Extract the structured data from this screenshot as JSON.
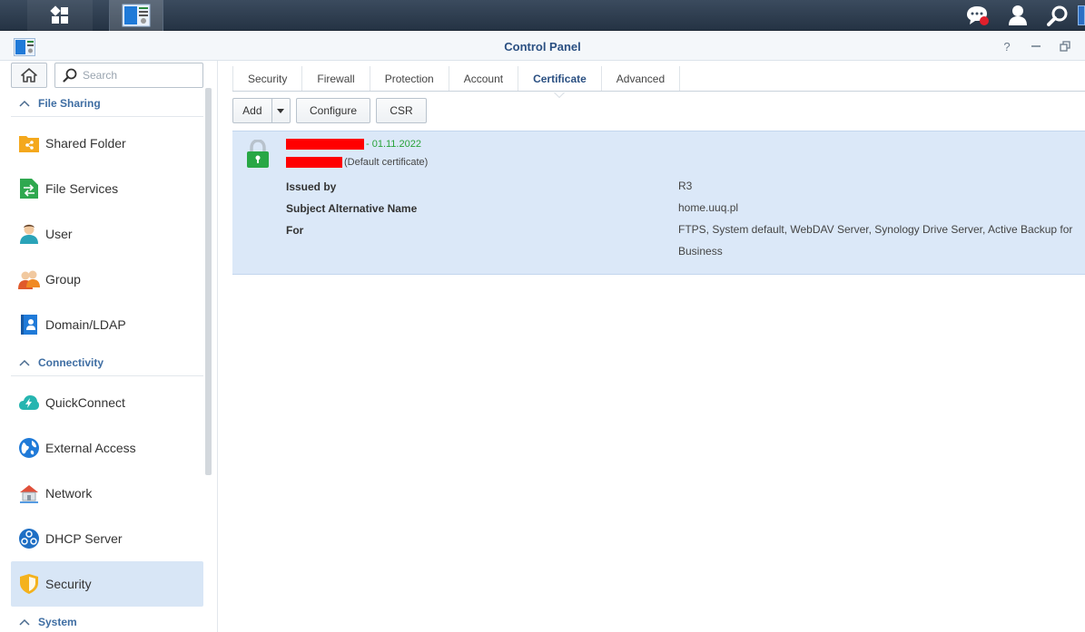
{
  "window": {
    "title": "Control Panel"
  },
  "sidebar": {
    "search_placeholder": "Search",
    "sections": [
      {
        "label": "File Sharing"
      },
      {
        "label": "Connectivity"
      },
      {
        "label": "System"
      }
    ],
    "items": [
      {
        "label": "Shared Folder",
        "icon": "shared-folder-icon"
      },
      {
        "label": "File Services",
        "icon": "file-services-icon"
      },
      {
        "label": "User",
        "icon": "user-icon"
      },
      {
        "label": "Group",
        "icon": "group-icon"
      },
      {
        "label": "Domain/LDAP",
        "icon": "domain-ldap-icon"
      },
      {
        "label": "QuickConnect",
        "icon": "quickconnect-icon"
      },
      {
        "label": "External Access",
        "icon": "external-access-icon"
      },
      {
        "label": "Network",
        "icon": "network-icon"
      },
      {
        "label": "DHCP Server",
        "icon": "dhcp-server-icon"
      },
      {
        "label": "Security",
        "icon": "security-icon",
        "active": true
      }
    ]
  },
  "tabs": [
    {
      "label": "Security"
    },
    {
      "label": "Firewall"
    },
    {
      "label": "Protection"
    },
    {
      "label": "Account"
    },
    {
      "label": "Certificate",
      "active": true
    },
    {
      "label": "Advanced"
    }
  ],
  "toolbar": {
    "add_label": "Add",
    "configure_label": "Configure",
    "csr_label": "CSR"
  },
  "certificate": {
    "expiry": "- 01.11.2022",
    "default_note": "(Default certificate)",
    "fields": [
      {
        "key": "Issued by",
        "value": "R3"
      },
      {
        "key": "Subject Alternative Name",
        "value": "home.uuq.pl"
      },
      {
        "key": "For",
        "value": "FTPS, System default, WebDAV Server, Synology Drive Server, Active Backup for Business"
      }
    ]
  },
  "colors": {
    "accent": "#2b5082",
    "selected": "#d8e6f6",
    "panel": "#dbe8f8",
    "valid_green": "#29a33a",
    "redaction": "#ff0000"
  }
}
